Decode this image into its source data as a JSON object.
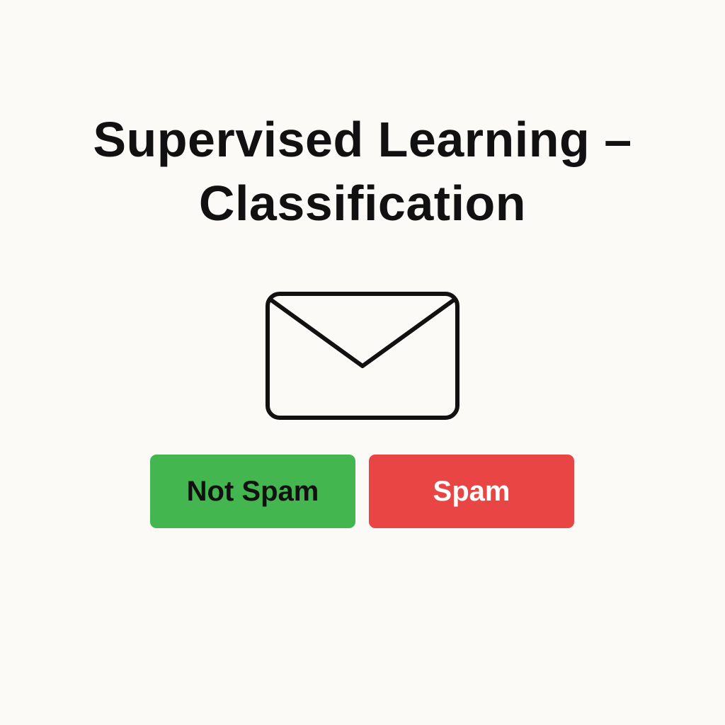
{
  "title": {
    "line1": "Supervised Learning –",
    "line2": "Classification"
  },
  "email_icon": {
    "name": "envelope-icon",
    "stroke_color": "#111111"
  },
  "buttons": {
    "not_spam": {
      "label": "Not Spam",
      "background": "#44b64f",
      "text_color": "#111111"
    },
    "spam": {
      "label": "Spam",
      "background": "#e94545",
      "text_color": "#ffffff"
    }
  },
  "theme": {
    "background": "#fbfaf7",
    "text": "#111111"
  }
}
